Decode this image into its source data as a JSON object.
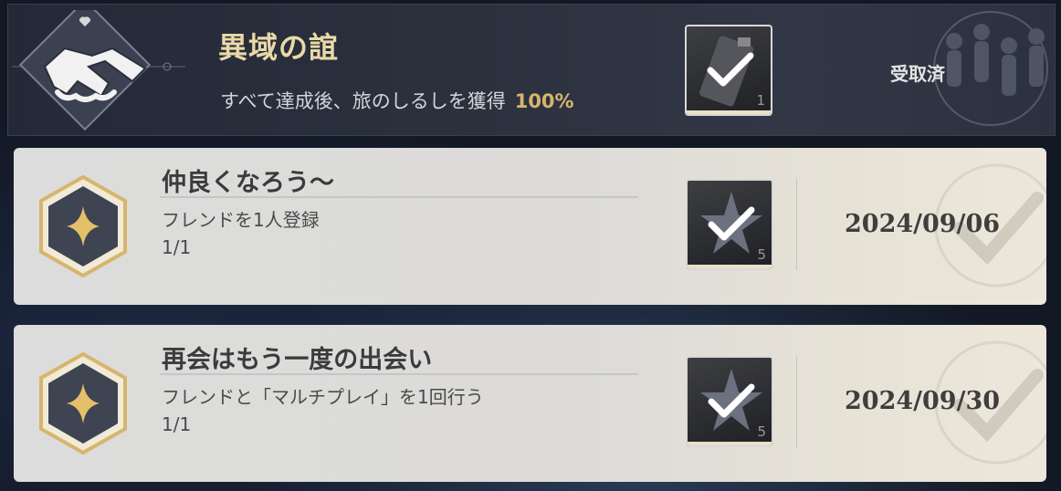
{
  "header": {
    "title": "異域の誼",
    "subtitle": "すべて達成後、旅のしるしを獲得",
    "progress": "100%",
    "reward_count": "1",
    "status": "受取済",
    "emblem_icon": "handshake-icon"
  },
  "missions": [
    {
      "title": "仲良くなろう～",
      "description": "フレンドを1人登録",
      "progress": "1/1",
      "reward_count": "5",
      "completed_date": "2024/09/06",
      "icon": "star-hex-icon"
    },
    {
      "title": "再会はもう一度の出会い",
      "description": "フレンドと「マルチプレイ」を1回行う",
      "progress": "1/1",
      "reward_count": "5",
      "completed_date": "2024/09/30",
      "icon": "star-hex-icon"
    }
  ],
  "colors": {
    "title_gold": "#ead9a8",
    "percent_gold": "#d6b56c",
    "card_bg": "#dcdcdc",
    "hex_border": "#d6b56c"
  }
}
